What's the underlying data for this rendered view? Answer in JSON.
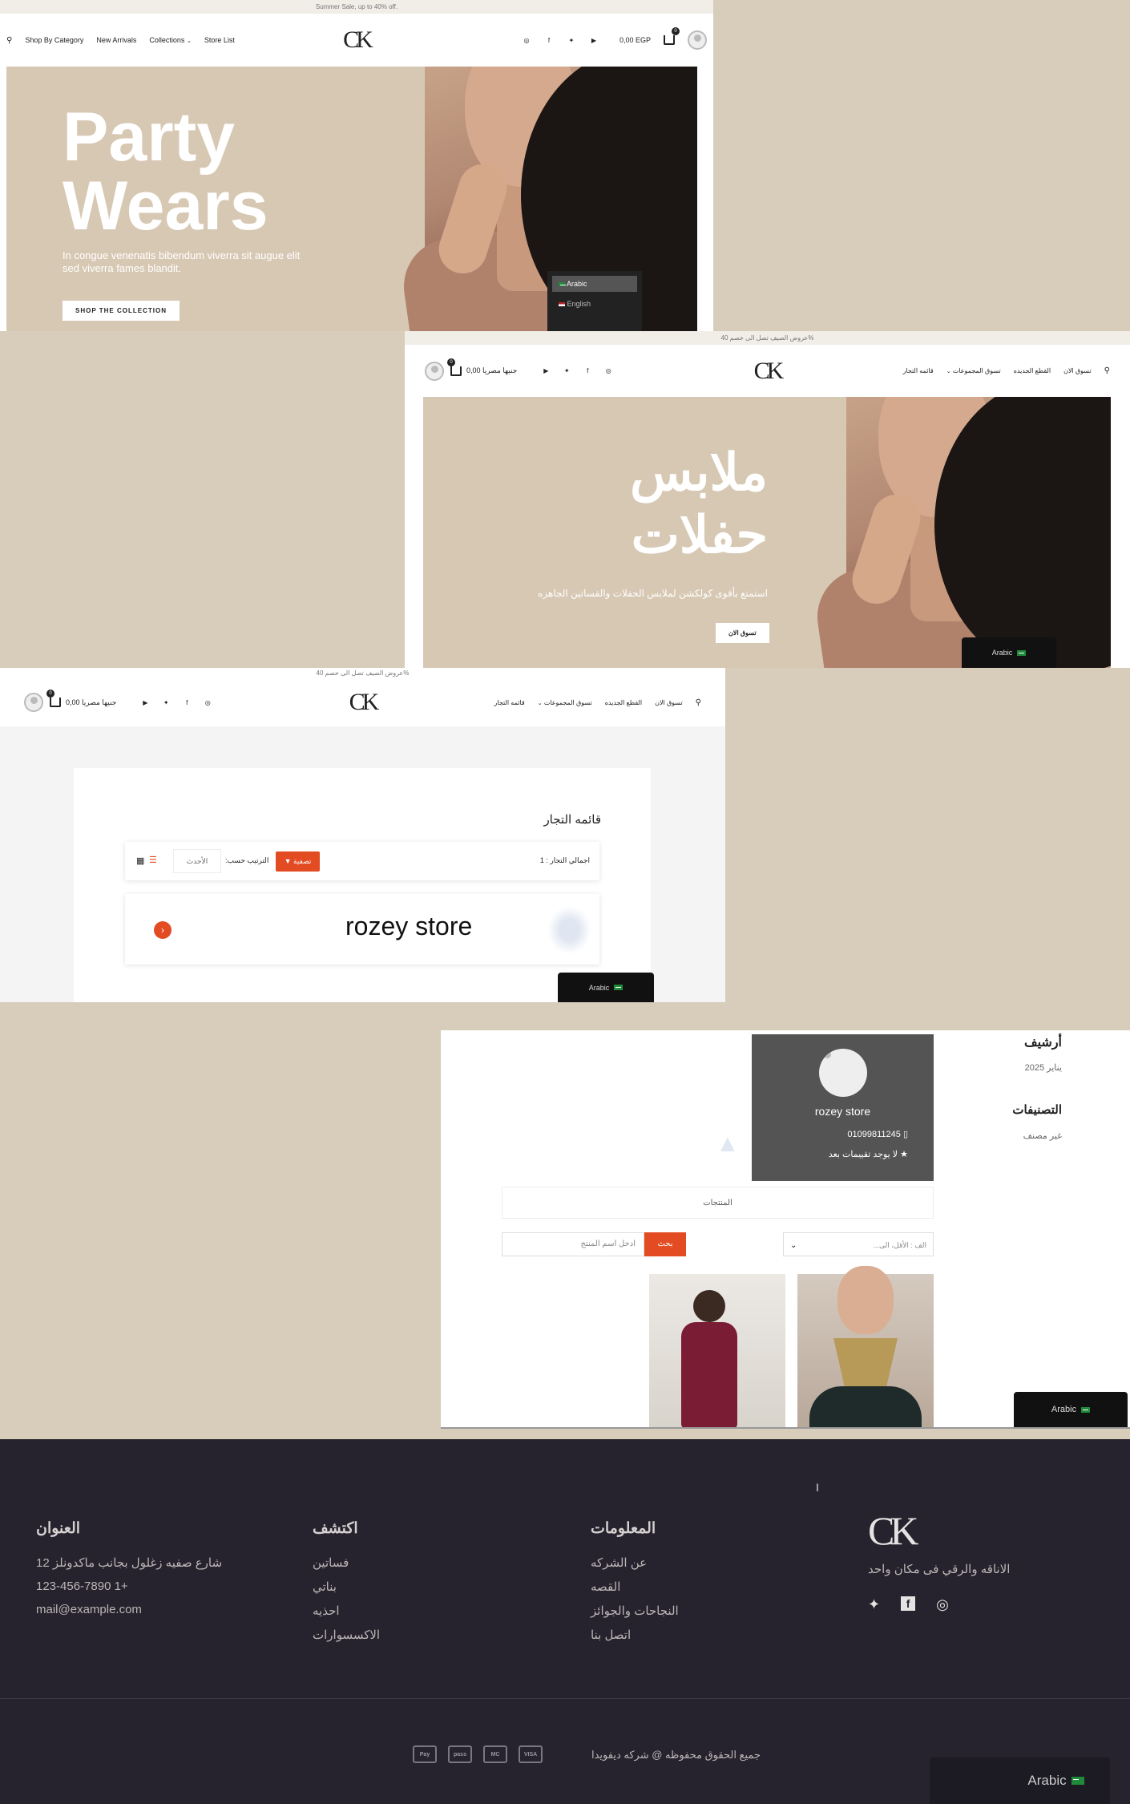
{
  "screen1": {
    "announcement": "Summer Sale, up to 40% off.",
    "nav": [
      "Shop By Category",
      "New Arrivals",
      "Collections",
      "Store List"
    ],
    "logo": "CK",
    "cart_total": "0,00 EGP",
    "cart_count": "0",
    "hero_title_1": "Party",
    "hero_title_2": "Wears",
    "hero_subtitle": "In congue venenatis bibendum viverra sit augue elit sed viverra fames blandit.",
    "hero_button": "SHOP THE COLLECTION",
    "lang_options": [
      "Arabic",
      "English"
    ]
  },
  "screen2": {
    "announcement": "عروض الصيف تصل الى خصم 40%",
    "nav": [
      "تسوق الان",
      "القطع الجديده",
      "تسوق المجموعات",
      "قائمه التجار"
    ],
    "logo": "CK",
    "cart_total": "0,00 جنيها مصريا",
    "cart_count": "0",
    "hero_title_1": "ملابس",
    "hero_title_2": "حفلات",
    "hero_subtitle": "استمتع بأقوى كولكشن لملابس الحفلات والفساتين الجاهزه",
    "hero_button": "تسوق الان",
    "lang": "Arabic"
  },
  "screen3": {
    "announcement": "عروض الصيف تصل الى خصم 40%",
    "nav": [
      "تسوق الان",
      "القطع الجديده",
      "تسوق المجموعات",
      "قائمه التجار"
    ],
    "logo": "CK",
    "cart_total": "0,00 جنيها مصريا",
    "cart_count": "0",
    "page_title": "قائمه التجار",
    "total_label": "اجمالي التجار : 1",
    "filter_button": "تصفية",
    "sort_label": "الترتيب حسب:",
    "sort_value": "الأحدث",
    "store_name": "rozey store",
    "lang": "Arabic"
  },
  "screen4": {
    "archive_title": "أرشيف",
    "archive_item": "يناير 2025",
    "categories_title": "التصنيفات",
    "categories_item": "غير مصنف",
    "store_name": "rozey store",
    "phone": "01099811245",
    "rating": "لا يوجد تقييمات بعد",
    "products_tab": "المنتجات",
    "search_placeholder": "ادخل اسم المنتج",
    "search_button": "بحث",
    "sort_select": "الف : الأقل، الى...",
    "lang": "Arabic"
  },
  "footer": {
    "col_address_title": "العنوان",
    "address": "12 شارع صفيه زغلول بجانب ماكدونلز",
    "phone": "123-456-7890 1+",
    "email": "mail@example.com",
    "col_discover_title": "اكتشف",
    "discover": [
      "فساتين",
      "بناتي",
      "احذيه",
      "الاكسسوارات"
    ],
    "col_info_title": "المعلومات",
    "info": [
      "عن الشركه",
      "القصه",
      "النجاحات والجوائز",
      "اتصل بنا"
    ],
    "logo": "CK",
    "tagline": "الاناقه والرقي فى مكان واحد",
    "copyright": "جميع الحقوق محفوظه @ شركه ديفويدا",
    "payments": [
      "Pay",
      "pass",
      "MC",
      "VISA"
    ],
    "lang": "Arabic"
  }
}
